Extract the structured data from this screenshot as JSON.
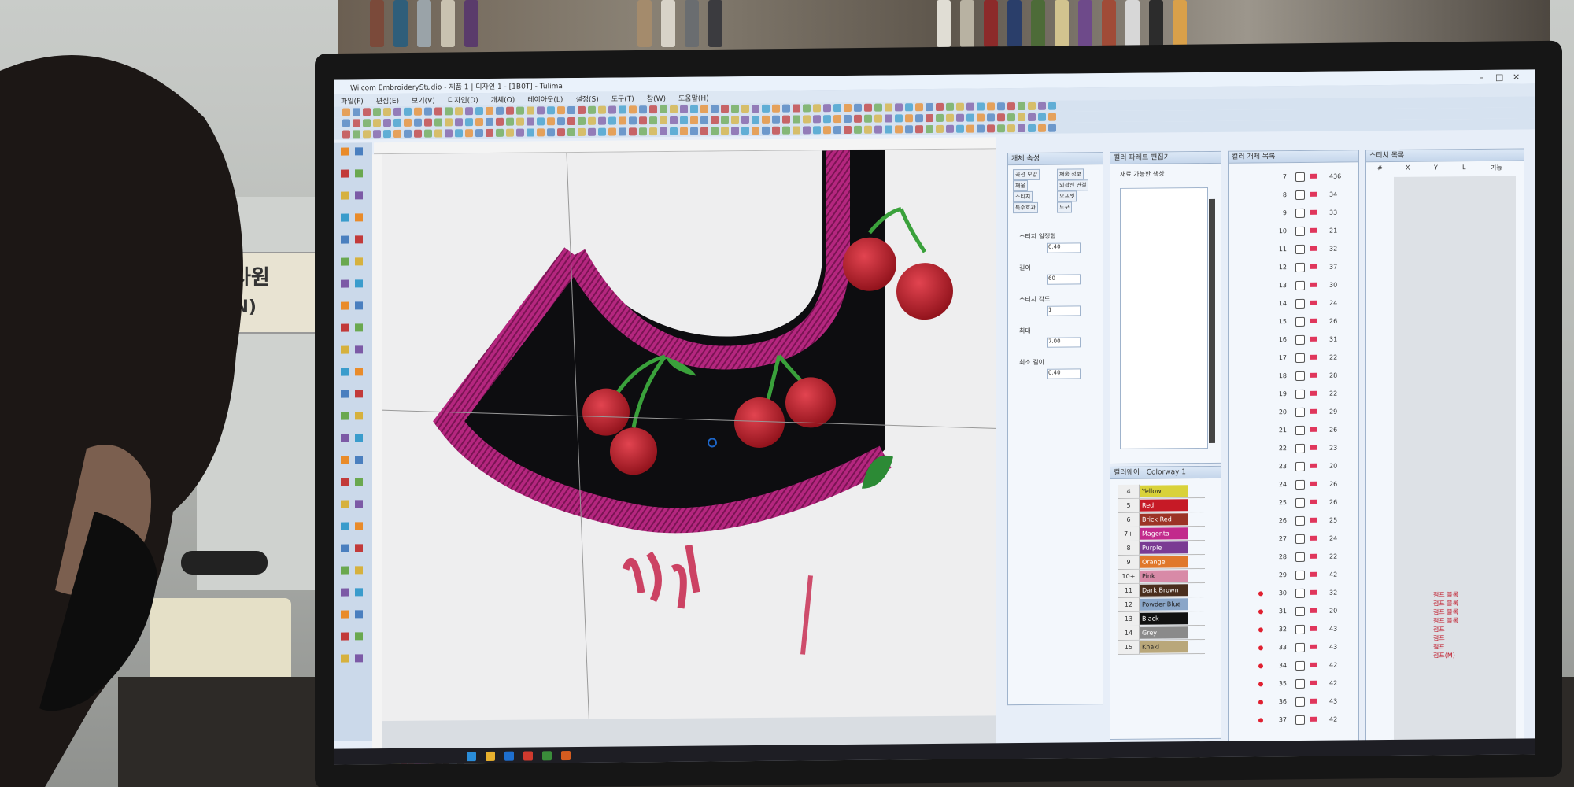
{
  "sign": {
    "line1": "련 사원",
    "line2": "HAN)"
  },
  "window": {
    "title": "Wilcom EmbroideryStudio - 제품 1 | 디자인 1 - [1B0T] - Tulima"
  },
  "menu": [
    "파일(F)",
    "편집(E)",
    "보기(V)",
    "디자인(D)",
    "개체(O)",
    "레이아웃(L)",
    "설정(S)",
    "도구(T)",
    "창(W)",
    "도움말(H)"
  ],
  "object_panel": {
    "title": "개체 속성",
    "buttons": [
      "곡선 모양",
      "채움 정보",
      "채움",
      "외곽선 연결",
      "스티치",
      "오프셋",
      "특수효과",
      "도구"
    ],
    "fields": [
      {
        "label": "스티치 일정함",
        "value": "0.40"
      },
      {
        "label": "길이",
        "value": "60"
      },
      {
        "label": "스티치 각도",
        "value": "1"
      },
      {
        "label": "최대",
        "value": "7.00"
      },
      {
        "label": "최소 길이",
        "value": "0.40"
      }
    ]
  },
  "color_panel": {
    "title": "컬러 파레트 편집기",
    "sub": "재료 가능한 색상",
    "footer_title": "컬러웨이",
    "colorway": "Colorway 1",
    "rows": [
      {
        "num": "4",
        "name": "Yellow",
        "color": "#d9d23a"
      },
      {
        "num": "5",
        "name": "Red",
        "color": "#c61a26"
      },
      {
        "num": "6",
        "name": "Brick Red",
        "color": "#9c3326"
      },
      {
        "num": "7+",
        "name": "Magenta",
        "color": "#c22a8c"
      },
      {
        "num": "8",
        "name": "Purple",
        "color": "#7a3b93"
      },
      {
        "num": "9",
        "name": "Orange",
        "color": "#e0782b"
      },
      {
        "num": "10+",
        "name": "Pink",
        "color": "#d88aa7"
      },
      {
        "num": "11",
        "name": "Dark Brown",
        "color": "#4a2e1d"
      },
      {
        "num": "12",
        "name": "Powder Blue",
        "color": "#8aa6c8"
      },
      {
        "num": "13",
        "name": "Black",
        "color": "#111111"
      },
      {
        "num": "14",
        "name": "Grey",
        "color": "#8a8a8a"
      },
      {
        "num": "15",
        "name": "Khaki",
        "color": "#b9a77a"
      }
    ]
  },
  "sequence_panel": {
    "title": "컬러 개체 목록",
    "rows": [
      "7",
      "8",
      "9",
      "10",
      "11",
      "12",
      "13",
      "14",
      "15",
      "16",
      "17",
      "18",
      "19",
      "20",
      "21",
      "22",
      "23",
      "24",
      "25",
      "26",
      "27",
      "28",
      "29",
      "30",
      "31",
      "32",
      "33",
      "34",
      "35",
      "36",
      "37"
    ],
    "values": [
      "436",
      "34",
      "33",
      "21",
      "32",
      "37",
      "30",
      "24",
      "26",
      "31",
      "22",
      "28",
      "22",
      "29",
      "26",
      "23",
      "20",
      "26",
      "26",
      "25",
      "24",
      "22",
      "42",
      "32",
      "20",
      "43",
      "43",
      "42",
      "42",
      "43",
      "42"
    ]
  },
  "stitch_panel": {
    "title": "스티치 목록",
    "headers": [
      "#",
      "X",
      "Y",
      "L",
      "기능"
    ],
    "footer_items": [
      "점프 블록",
      "점프 블록",
      "점프 블록",
      "점프 블록",
      "점프",
      "점프",
      "점프",
      "점프(M)"
    ]
  },
  "colors": {
    "thread_border": "#b5267f",
    "thread_dark": "#7a1453",
    "cherry": "#c3222e",
    "stem": "#3aa13b",
    "fabric": "#0d0d10"
  }
}
